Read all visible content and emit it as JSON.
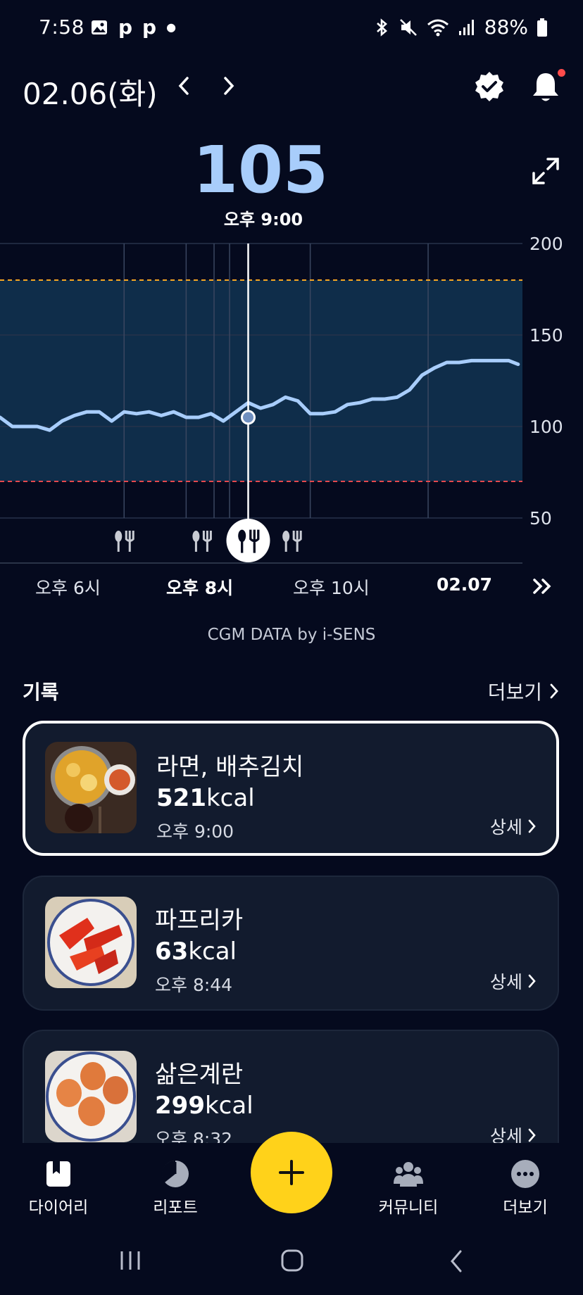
{
  "status_bar": {
    "time": "7:58",
    "left_icons": [
      "photo-icon",
      "p-icon",
      "p-icon",
      "dot-icon"
    ],
    "battery": "88%"
  },
  "header": {
    "date": "02.06(화)"
  },
  "reading": {
    "value": "105",
    "time": "오후 9:00"
  },
  "chart_data": {
    "type": "line",
    "x_tick_labels": [
      "오후 6시",
      "오후 8시",
      "오후 10시",
      "02.07"
    ],
    "y_ticks": [
      200,
      150,
      100,
      50
    ],
    "ylim": [
      50,
      200
    ],
    "target_range": [
      70,
      180
    ],
    "series": [
      {
        "x_hours": [
          17.0,
          17.2,
          17.4,
          17.6,
          17.8,
          18.0,
          18.2,
          18.4,
          18.6,
          18.8,
          19.0,
          19.2,
          19.4,
          19.6,
          19.8,
          20.0,
          20.2,
          20.4,
          20.6,
          20.8,
          21.0,
          21.2,
          21.4,
          21.6,
          21.8,
          22.0,
          22.2,
          22.4,
          22.6,
          22.8,
          23.0,
          23.2,
          23.4,
          23.6,
          23.8,
          24.0,
          24.2,
          24.4,
          24.6,
          24.8,
          25.0,
          25.2,
          25.35
        ],
        "values": [
          105,
          100,
          100,
          100,
          98,
          103,
          106,
          108,
          108,
          103,
          108,
          107,
          108,
          106,
          108,
          105,
          105,
          107,
          103,
          108,
          113,
          110,
          112,
          116,
          114,
          107,
          107,
          108,
          112,
          113,
          115,
          115,
          116,
          120,
          128,
          132,
          135,
          135,
          136,
          136,
          136,
          136,
          134
        ]
      }
    ],
    "selected": {
      "x_hours": 21.0,
      "value": 105
    },
    "meal_markers_hours": [
      19.0,
      20.25,
      21.0,
      21.7
    ]
  },
  "chart_meta": {
    "credit": "CGM DATA by i-SENS"
  },
  "records": {
    "title": "기록",
    "more": "더보기",
    "items": [
      {
        "name": "라면, 배추김치",
        "kcal_value": "521",
        "kcal_unit": "kcal",
        "time": "오후 9:00",
        "detail": "상세"
      },
      {
        "name": "파프리카",
        "kcal_value": "63",
        "kcal_unit": "kcal",
        "time": "오후 8:44",
        "detail": "상세"
      },
      {
        "name": "삶은계란",
        "kcal_value": "299",
        "kcal_unit": "kcal",
        "time": "오후 8:32",
        "detail": "상세"
      }
    ]
  },
  "bottom_nav": {
    "items": [
      {
        "label": "다이어리",
        "icon": "diary-icon"
      },
      {
        "label": "리포트",
        "icon": "report-icon"
      },
      {
        "label": "커뮤니티",
        "icon": "community-icon"
      },
      {
        "label": "더보기",
        "icon": "more-dots-icon"
      }
    ]
  },
  "colors": {
    "background": "#050a1e",
    "card": "#121b2e",
    "glucose_line": "#a8cdfb",
    "target_band": "#0f2d4a",
    "upper_limit": "#f5a623",
    "lower_limit": "#e5484d",
    "fab": "#ffd21a"
  }
}
